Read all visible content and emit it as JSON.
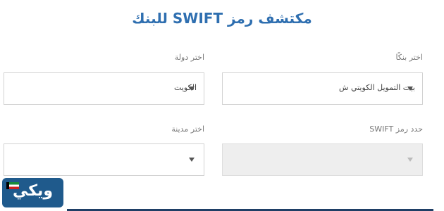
{
  "page": {
    "title": "مكتشف رمز SWIFT للبنك"
  },
  "form": {
    "bank": {
      "label": "اختر بنكًا",
      "value": "بيت التمويل الكويتي ش"
    },
    "country": {
      "label": "اختر دولة",
      "value": "الكويت"
    },
    "swift_code": {
      "label": "حدد رمز SWIFT",
      "value": ""
    },
    "city": {
      "label": "اختر مدينة",
      "value": ""
    }
  },
  "logo": {
    "text": "ويكي",
    "flag_icon": "kuwait-flag-icon"
  },
  "colors": {
    "title": "#2f6fb0",
    "logo_bg": "#1f5a8c"
  }
}
